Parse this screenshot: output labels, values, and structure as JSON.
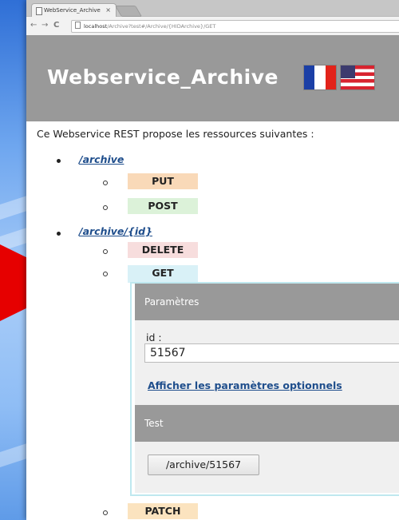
{
  "browser": {
    "tab_title": "WebService_Archive",
    "tab_close": "×",
    "back": "←",
    "forward": "→",
    "reload": "C",
    "url_host": "localhost",
    "url_path": "/Archive?test#/Archive/{HIDArchive}/GET"
  },
  "header": {
    "title": "Webservice_Archive",
    "flags": [
      "french-flag",
      "us-flag"
    ]
  },
  "main": {
    "intro": "Ce Webservice REST propose les ressources suivantes :",
    "resources": [
      {
        "path": "/archive",
        "methods": [
          {
            "label": "PUT",
            "color": "#f9d9b8"
          },
          {
            "label": "POST",
            "color": "#dcf2d9"
          }
        ]
      },
      {
        "path": "/archive/{id}",
        "methods": [
          {
            "label": "DELETE",
            "color": "#f7dddd"
          },
          {
            "label": "GET",
            "color": "#d9f1f7"
          },
          {
            "label": "PATCH",
            "color": "#fbe3bf"
          }
        ]
      }
    ]
  },
  "panel": {
    "params_header": "Paramètres",
    "id_label": "id :",
    "id_value": "51567",
    "optional_link": "Afficher les paramètres optionnels",
    "test_header": "Test",
    "test_button": "/archive/51567"
  },
  "colors": {
    "header_bg": "#999999",
    "link": "#1f4e8c",
    "panel_border": "#bfe8ef",
    "arrow": "#e60000"
  }
}
